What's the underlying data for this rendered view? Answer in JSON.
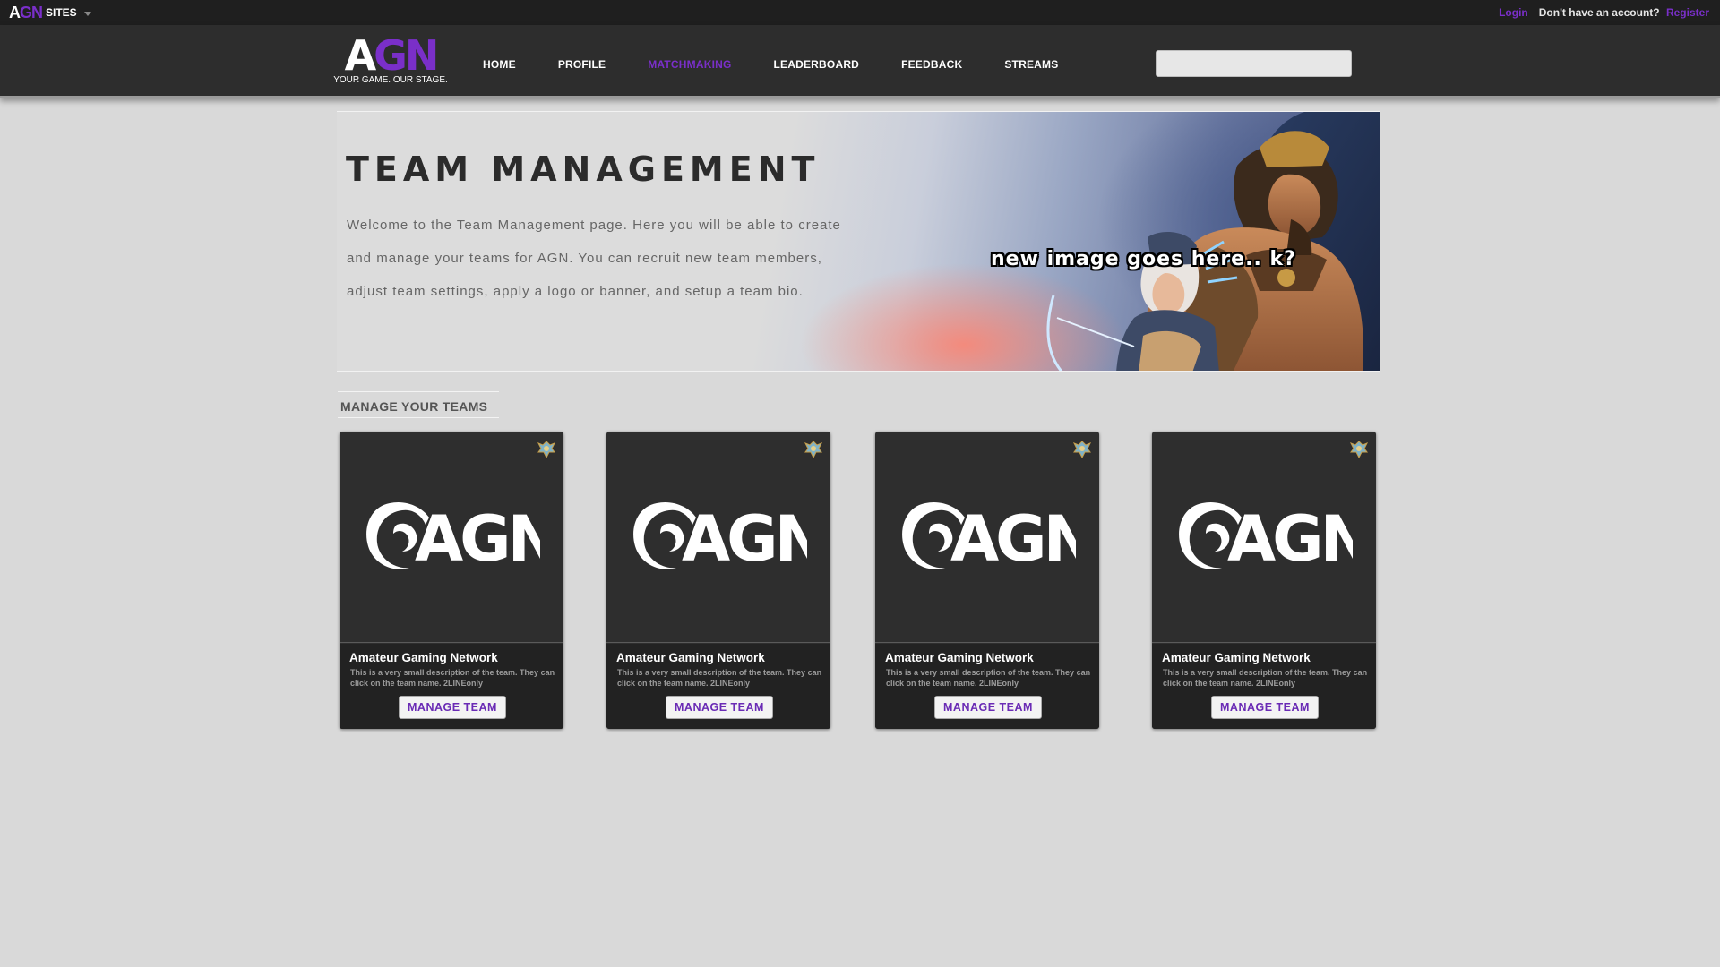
{
  "topbar": {
    "sites_logo_a": "A",
    "sites_logo_gn": "GN",
    "sites_label": "SITES",
    "login": "Login",
    "no_account": "Don't have an account?",
    "register": "Register"
  },
  "header": {
    "brand_a": "A",
    "brand_gn": "GN",
    "tagline": "YOUR GAME. OUR STAGE.",
    "nav": [
      "HOME",
      "PROFILE",
      "MATCHMAKING",
      "LEADERBOARD",
      "FEEDBACK",
      "STREAMS"
    ],
    "active_nav": "MATCHMAKING",
    "search_value": ""
  },
  "hero": {
    "title": "TEAM MANAGEMENT",
    "text": "Welcome to the Team Management page. Here you will be able to create and manage your teams for AGN. You can recruit new team members, adjust team settings, apply a logo or banner, and setup a team bio.",
    "overlay": "new image goes here.. k?"
  },
  "section": {
    "heading": "MANAGE YOUR TEAMS"
  },
  "teams": [
    {
      "name": "Amateur Gaming Network",
      "logo_text": "AGN",
      "desc": "This is a very small description of the team. They can click on the team name. 2LINEonly",
      "button": "MANAGE TEAM"
    },
    {
      "name": "Amateur Gaming Network",
      "logo_text": "AGN",
      "desc": "This is a very small description of the team. They can click on the team name. 2LINEonly",
      "button": "MANAGE TEAM"
    },
    {
      "name": "Amateur Gaming Network",
      "logo_text": "AGN",
      "desc": "This is a very small description of the team. They can click on the team name. 2LINEonly",
      "button": "MANAGE TEAM"
    },
    {
      "name": "Amateur Gaming Network",
      "logo_text": "AGN",
      "desc": "This is a very small description of the team. They can click on the team name. 2LINEonly",
      "button": "MANAGE TEAM"
    }
  ],
  "icons": {
    "badge": "rank-badge-icon",
    "caret": "chevron-down-icon",
    "team_logo": "agn-swirl-logo"
  },
  "colors": {
    "accent": "#7a2fc9",
    "topbar_bg": "#1f1f1f",
    "header_bg": "#2d2d2d",
    "page_bg": "#d9d9d9",
    "card_bg": "#2e2e2e"
  }
}
